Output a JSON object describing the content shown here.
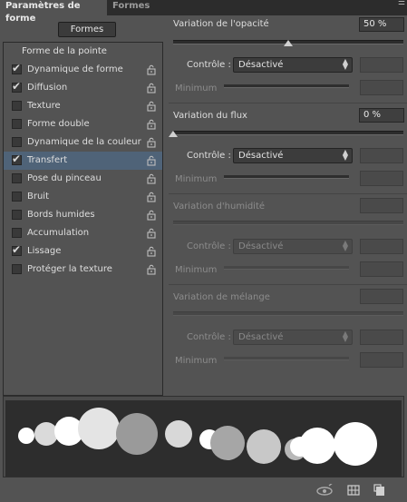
{
  "tabs": [
    {
      "label": "Paramètres de forme"
    },
    {
      "label": "Formes"
    }
  ],
  "panel_menu_icon": "panel-menu-icon",
  "formes_button": "Formes",
  "list": {
    "header": "Forme de la pointe",
    "options": [
      {
        "label": "Dynamique de forme",
        "checked": true,
        "locked_icon": "lock-icon"
      },
      {
        "label": "Diffusion",
        "checked": true,
        "locked_icon": "lock-icon"
      },
      {
        "label": "Texture",
        "checked": false,
        "locked_icon": "lock-icon"
      },
      {
        "label": "Forme double",
        "checked": false,
        "locked_icon": "lock-icon"
      },
      {
        "label": "Dynamique de la couleur",
        "checked": false,
        "locked_icon": "lock-icon"
      },
      {
        "label": "Transfert",
        "checked": true,
        "selected": true,
        "locked_icon": "lock-icon"
      },
      {
        "label": "Pose du pinceau",
        "checked": false,
        "locked_icon": "lock-icon"
      },
      {
        "label": "Bruit",
        "checked": false,
        "locked_icon": "lock-icon"
      },
      {
        "label": "Bords humides",
        "checked": false,
        "locked_icon": "lock-icon"
      },
      {
        "label": "Accumulation",
        "checked": false,
        "locked_icon": "lock-icon"
      },
      {
        "label": "Lissage",
        "checked": true,
        "locked_icon": "lock-icon"
      },
      {
        "label": "Protéger la texture",
        "checked": false,
        "locked_icon": "lock-icon"
      }
    ]
  },
  "settings": {
    "opacity": {
      "label": "Variation de l'opacité",
      "value": "50 %",
      "slider_fraction": 0.5,
      "control_label": "Contrôle :",
      "control_value": "Désactivé",
      "minimum_label": "Minimum"
    },
    "flow": {
      "label": "Variation du flux",
      "value": "0 %",
      "slider_fraction": 0.0,
      "control_label": "Contrôle :",
      "control_value": "Désactivé",
      "minimum_label": "Minimum"
    },
    "wetness": {
      "label": "Variation d'humidité",
      "control_label": "Contrôle :",
      "control_value": "Désactivé",
      "minimum_label": "Minimum"
    },
    "mix": {
      "label": "Variation de mélange",
      "control_label": "Contrôle :",
      "control_value": "Désactivé",
      "minimum_label": "Minimum"
    }
  },
  "bottom_icons": [
    "brush-eye-icon",
    "grid-icon",
    "new-preset-icon"
  ],
  "colors": {
    "selected_row": "#4f6378",
    "panel_bg": "#535353",
    "preview_bg": "#2d2d2d"
  }
}
